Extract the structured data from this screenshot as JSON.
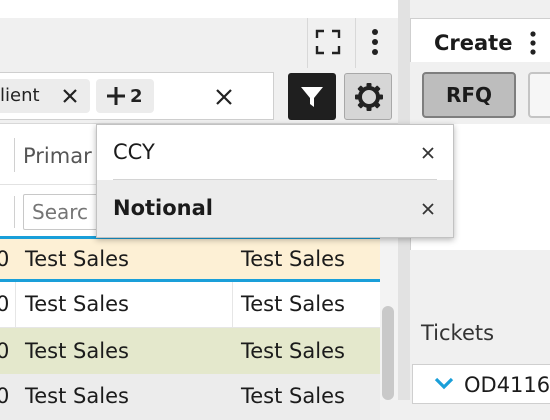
{
  "filter_bar": {
    "chip_client_label": "lient",
    "chip_more_label": "2",
    "search_value": ""
  },
  "grid": {
    "header_primary": "Primar",
    "filter_placeholder": "Searc",
    "rows": [
      {
        "lead": "0",
        "col1": "Test Sales",
        "col2": "Test Sales"
      },
      {
        "lead": "0",
        "col1": "Test Sales",
        "col2": "Test Sales"
      },
      {
        "lead": "0",
        "col1": "Test Sales",
        "col2": "Test Sales"
      },
      {
        "lead": "0",
        "col1": "Test Sales",
        "col2": "Test Sales"
      }
    ]
  },
  "dropdown": {
    "items": [
      {
        "label": "CCY"
      },
      {
        "label": "Notional"
      }
    ]
  },
  "create_panel": {
    "title": "Create",
    "rfq_label": "RFQ"
  },
  "tickets": {
    "title": "Tickets",
    "first_item": "OD4116"
  },
  "colors": {
    "accent_blue": "#1a9fd9",
    "row_highlight": "#fdf0d5",
    "row_green": "#e4e8cc",
    "dark_button": "#1f1f1f"
  }
}
